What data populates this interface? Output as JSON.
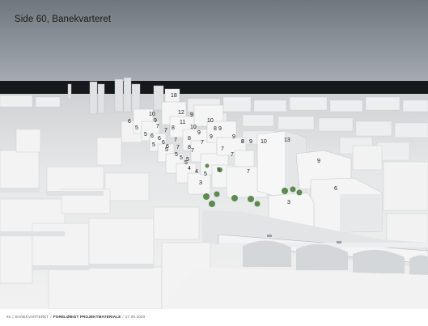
{
  "page_title": "Side 60, Banekvarteret",
  "footer": {
    "page_number": "60",
    "project": "BANEKVARTERET",
    "document_type": "FORELØBIGT PROJEKTMATERIALE",
    "date": "27.06.2020"
  },
  "height_labels": [
    "18",
    "12",
    "9",
    "10",
    "9",
    "7",
    "8",
    "11",
    "10",
    "9",
    "10",
    "6",
    "5",
    "7",
    "6",
    "6",
    "5",
    "6",
    "7",
    "8",
    "9",
    "8",
    "9",
    "9",
    "5",
    "6",
    "8",
    "7",
    "5",
    "7",
    "7",
    "5",
    "5",
    "5",
    "8",
    "7",
    "5",
    "4",
    "4",
    "5",
    "7",
    "3",
    "8",
    "9",
    "10",
    "13",
    "9",
    "6",
    "3",
    "7",
    "5"
  ],
  "colors": {
    "sky_top": "#6f767d",
    "sky_bottom": "#a3a9ae",
    "sea": "#15191d",
    "building": "#f3f3f3",
    "building_shade": "#d6d8da",
    "ground": "#e9eaeb",
    "tree": "#5d8a4e"
  }
}
